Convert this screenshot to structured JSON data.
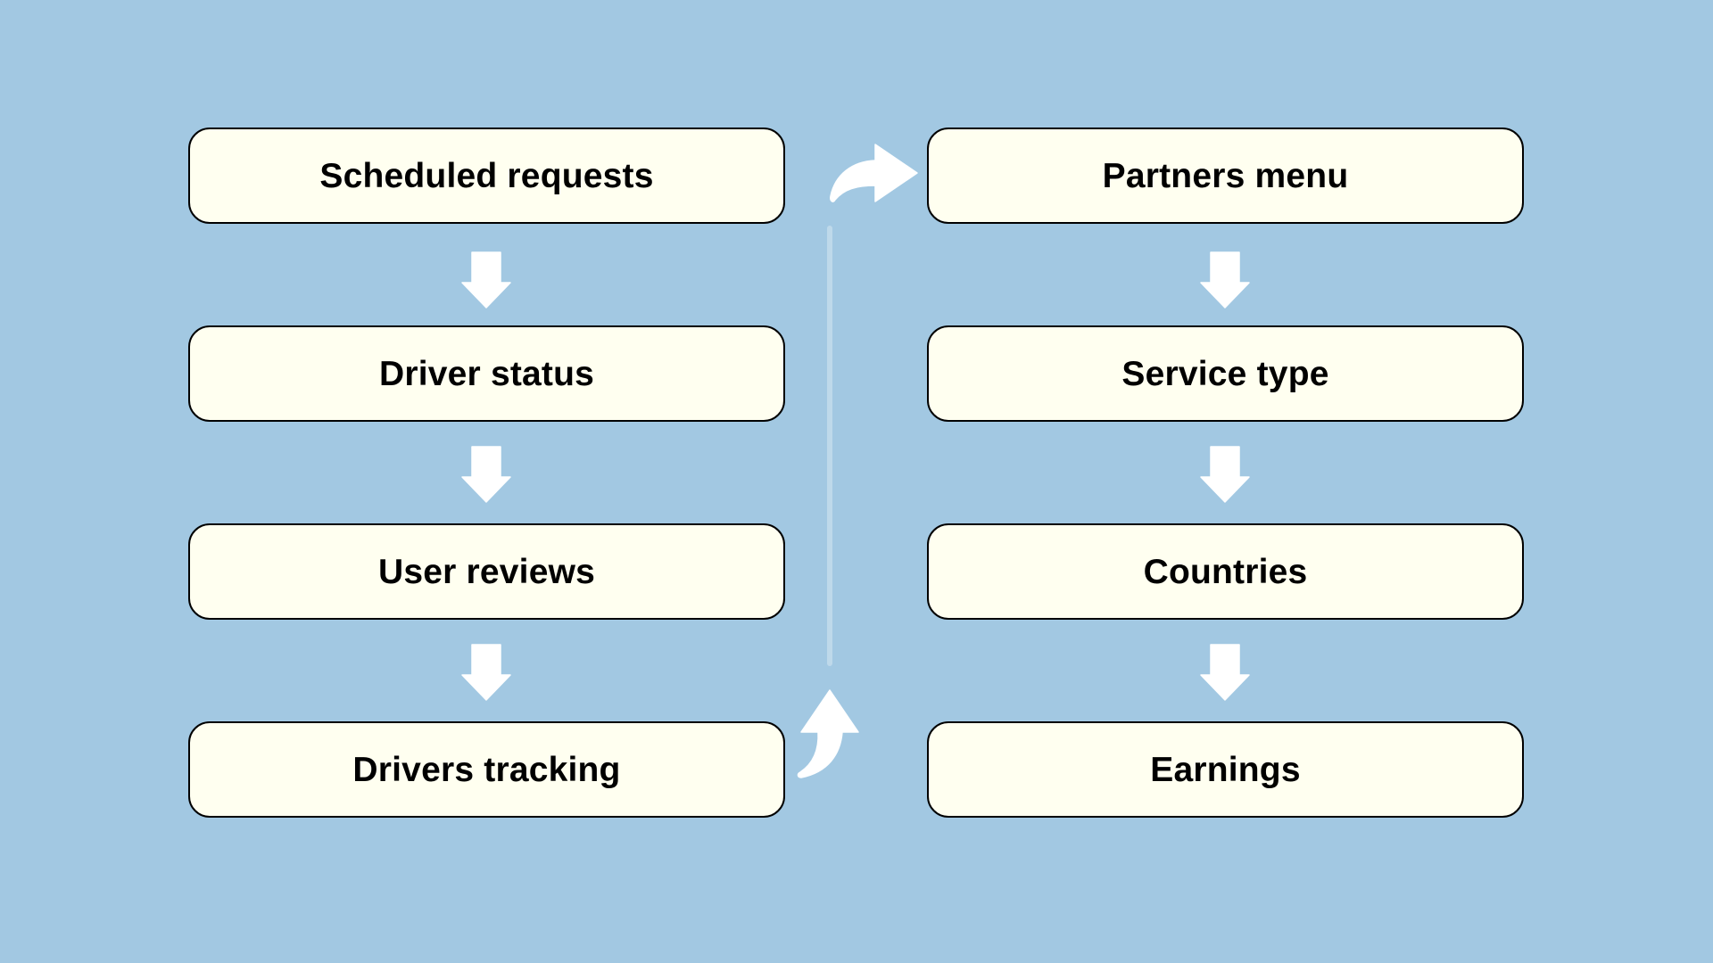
{
  "diagram": {
    "type": "flow",
    "background_color": "#a2c8e2",
    "box_fill_color": "#fffff0",
    "arrow_color": "#ffffff",
    "left_column": {
      "steps": [
        {
          "label": "Scheduled requests"
        },
        {
          "label": "Driver status"
        },
        {
          "label": "User reviews"
        },
        {
          "label": "Drivers tracking"
        }
      ]
    },
    "right_column": {
      "steps": [
        {
          "label": "Partners menu"
        },
        {
          "label": "Service type"
        },
        {
          "label": "Countries"
        },
        {
          "label": "Earnings"
        }
      ]
    },
    "connections": [
      {
        "from": "Scheduled requests",
        "to": "Driver status",
        "icon": "arrow-down-icon"
      },
      {
        "from": "Driver status",
        "to": "User reviews",
        "icon": "arrow-down-icon"
      },
      {
        "from": "User reviews",
        "to": "Drivers tracking",
        "icon": "arrow-down-icon"
      },
      {
        "from": "Drivers tracking",
        "to": "Partners menu",
        "icon": "curved-arrow-up-icon"
      },
      {
        "from": "Partners menu",
        "to": "Service type",
        "icon": "arrow-down-icon"
      },
      {
        "from": "Service type",
        "to": "Countries",
        "icon": "arrow-down-icon"
      },
      {
        "from": "Countries",
        "to": "Earnings",
        "icon": "arrow-down-icon"
      }
    ]
  }
}
